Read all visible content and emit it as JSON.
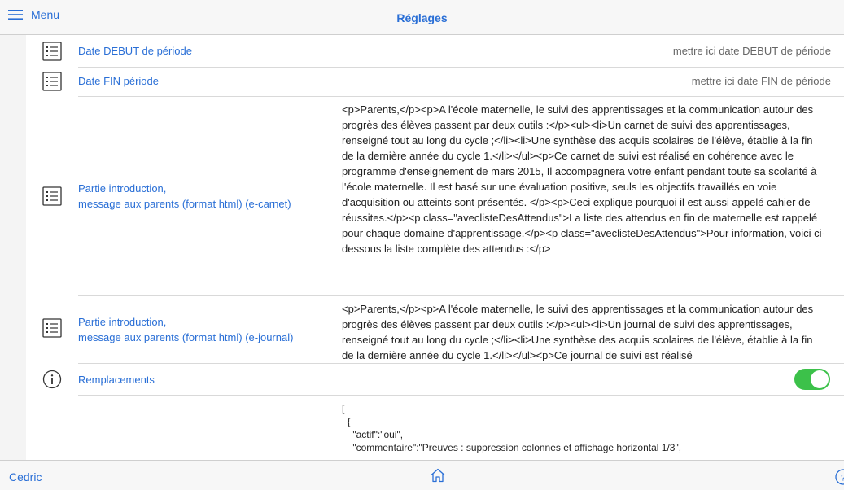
{
  "header": {
    "menu_label": "Menu",
    "title": "Réglages"
  },
  "rows": {
    "date_debut": {
      "label": "Date DEBUT de période",
      "value": "mettre ici date DEBUT de  période"
    },
    "date_fin": {
      "label": "Date FIN période",
      "value": "mettre ici date FIN de période"
    },
    "intro_ecarnet": {
      "label_line1": "Partie introduction,",
      "label_line2": "message aux parents (format html) (e-carnet)",
      "value": "<p>Parents,</p><p>A l'école maternelle, le suivi des apprentissages et la communication autour des progrès des élèves passent par deux outils :</p><ul><li>Un carnet de suivi des apprentissages, renseigné tout au long du cycle ;</li><li>Une synthèse des acquis scolaires de l'élève, établie à la fin de la dernière année du cycle 1.</li></ul><p>Ce carnet de suivi est réalisé en cohérence avec le programme d'enseignement de mars 2015, Il accompagnera votre enfant pendant toute sa scolarité à l'école maternelle. Il est basé sur une évaluation positive, seuls les objectifs travaillés en voie d'acquisition ou atteints sont présentés. </p><p>Ceci explique pourquoi il est aussi appelé cahier de réussites.</p><p class=\"aveclisteDesAttendus\">La liste des attendus en fin de maternelle est rappelé pour chaque domaine d'apprentissage.</p><p class=\"aveclisteDesAttendus\">Pour information, voici ci-dessous la liste complète des attendus :</p>"
    },
    "intro_ejournal": {
      "label_line1": "Partie introduction,",
      "label_line2": "message aux parents (format html) (e-journal)",
      "value": "<p>Parents,</p><p>A l'école maternelle, le suivi des apprentissages et la communication autour des progrès des élèves passent par deux outils :</p><ul><li>Un journal de suivi des apprentissages, renseigné tout au long du cycle ;</li><li>Une synthèse des acquis scolaires de l'élève, établie à la fin de la dernière année du cycle 1.</li></ul><p>Ce journal de suivi est réalisé"
    },
    "remplacements": {
      "label": "Remplacements",
      "enabled": true
    },
    "json_value": "[\n  {\n    \"actif\":\"oui\",\n    \"commentaire\":\"Preuves : suppression colonnes et affichage horizontal 1/3\","
  },
  "footer": {
    "user": "Cedric"
  },
  "colors": {
    "accent": "#2a6fd6",
    "toggle_on": "#3cc14a"
  },
  "icons": {
    "menu": "hamburger-icon",
    "list": "list-icon",
    "info": "info-icon",
    "home": "home-icon",
    "help": "help-icon"
  }
}
